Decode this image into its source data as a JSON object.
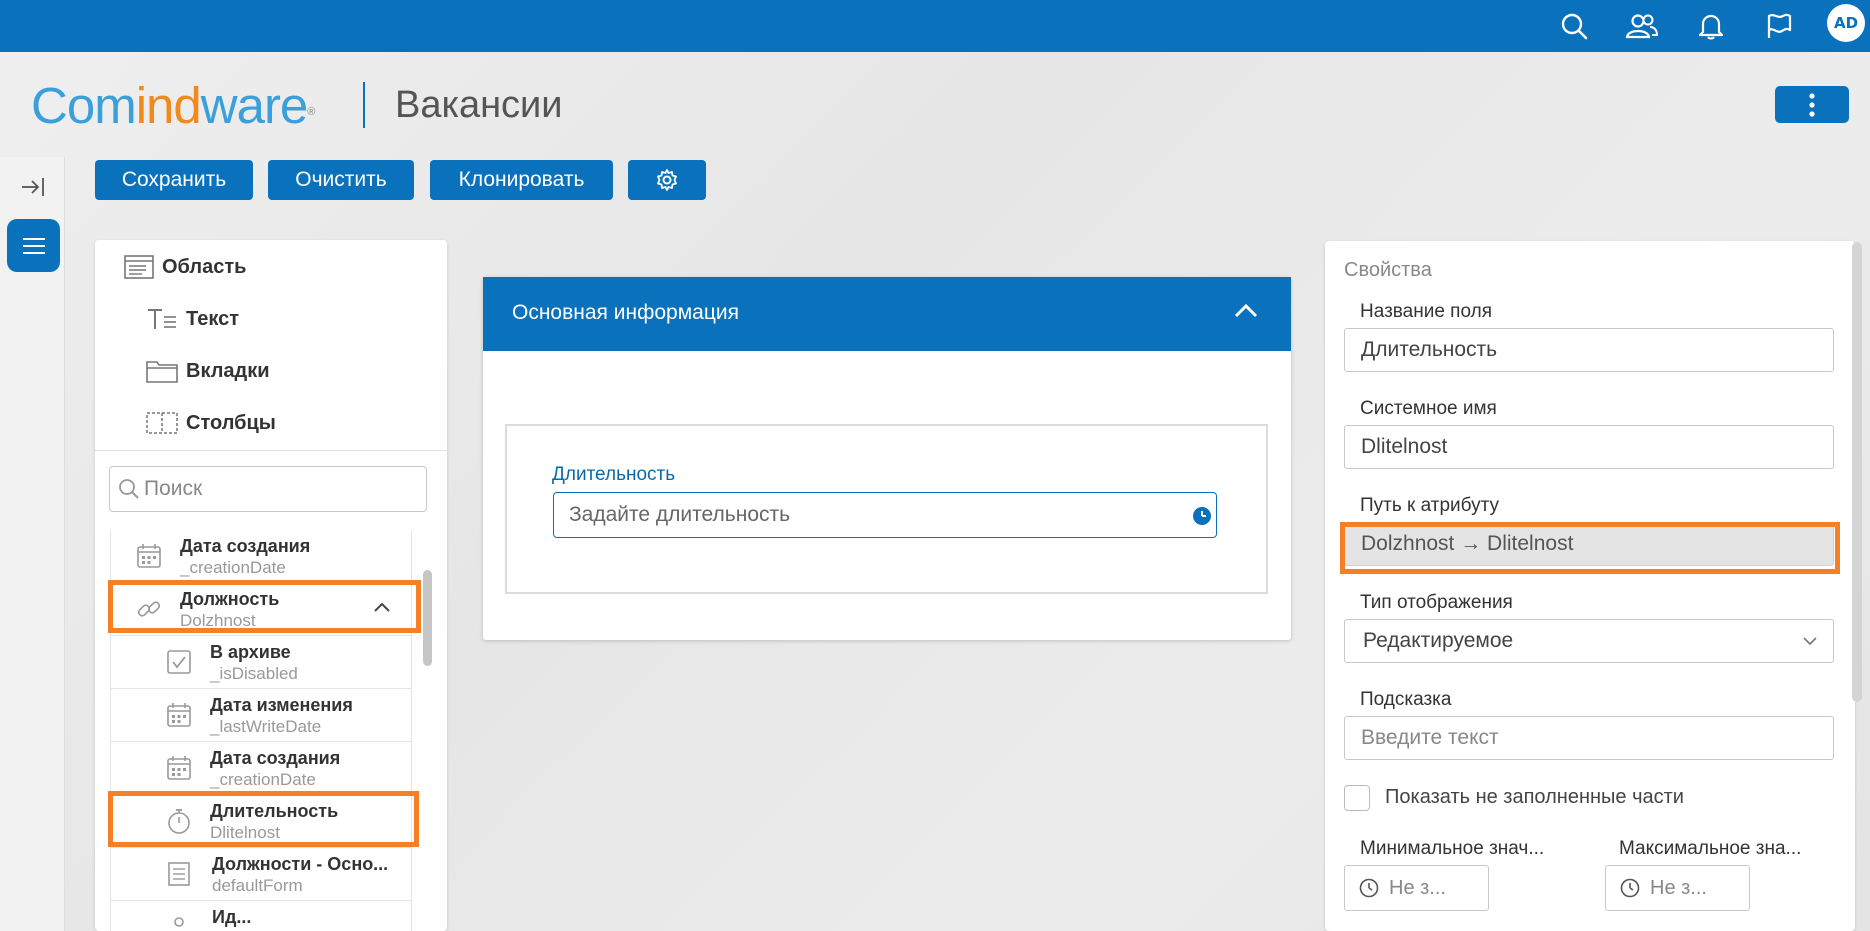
{
  "app": {
    "logo_part1": "Com",
    "logo_part2": "ind",
    "logo_part3": "ware",
    "logo_reg": "®",
    "title": "Вакансии",
    "user_initials": "AD"
  },
  "toolbar": {
    "save": "Сохранить",
    "clear": "Очистить",
    "clone": "Клонировать"
  },
  "palette": {
    "area": "Область",
    "text": "Текст",
    "tabs": "Вкладки",
    "columns": "Столбцы",
    "search_placeholder": "Поиск"
  },
  "tree": [
    {
      "label": "Дата создания",
      "system": "_creationDate",
      "icon": "calendar-icon"
    },
    {
      "label": "Должность",
      "system": "Dolzhnost",
      "icon": "link-icon",
      "expanded": true
    },
    {
      "label": "В архиве",
      "system": "_isDisabled",
      "icon": "checkbox-icon"
    },
    {
      "label": "Дата изменения",
      "system": "_lastWriteDate",
      "icon": "calendar-icon"
    },
    {
      "label": "Дата создания",
      "system": "_creationDate",
      "icon": "calendar-icon"
    },
    {
      "label": "Длительность",
      "system": "Dlitelnost",
      "icon": "stopwatch-icon"
    },
    {
      "label": "Должности - Осно...",
      "system": "defaultForm",
      "icon": "form-icon"
    },
    {
      "label": "Ид...",
      "system": "",
      "icon": "id-icon"
    }
  ],
  "form": {
    "section_title": "Основная информация",
    "field_label": "Длительность",
    "field_placeholder": "Задайте длительность"
  },
  "properties": {
    "title": "Свойства",
    "field_name_label": "Название поля",
    "field_name_value": "Длительность",
    "system_name_label": "Системное имя",
    "system_name_value": "Dlitelnost",
    "attr_path_label": "Путь к атрибуту",
    "attr_path_value": "Dolzhnost → Dlitelnost",
    "display_type_label": "Тип отображения",
    "display_type_value": "Редактируемое",
    "hint_label": "Подсказка",
    "hint_placeholder": "Введите текст",
    "show_empty_label": "Показать не заполненные части",
    "min_label": "Минимальное знач...",
    "max_label": "Максимальное зна...",
    "min_placeholder": "Не з...",
    "max_placeholder": "Не з..."
  },
  "colors": {
    "brand": "#0a72bd",
    "logo_blue": "#3aa0dc",
    "logo_orange": "#f08a1c",
    "highlight": "#f58025"
  }
}
